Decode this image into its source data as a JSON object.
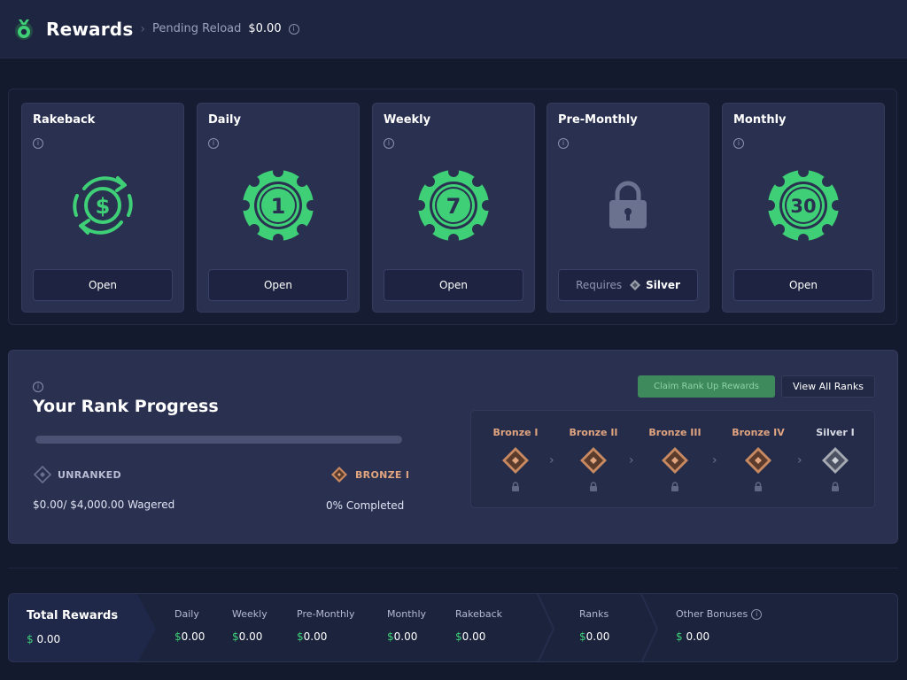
{
  "header": {
    "title": "Rewards",
    "pending_label": "Pending Reload",
    "pending_value": "$0.00"
  },
  "cards": [
    {
      "title": "Rakeback",
      "button": "Open",
      "icon": "rakeback-dollar-icon"
    },
    {
      "title": "Daily",
      "button": "Open",
      "chip_number": "1",
      "icon": "chip-icon"
    },
    {
      "title": "Weekly",
      "button": "Open",
      "chip_number": "7",
      "icon": "chip-icon"
    },
    {
      "title": "Pre-Monthly",
      "button_prefix": "Requires",
      "button_rank": "Silver",
      "icon": "lock-icon"
    },
    {
      "title": "Monthly",
      "button": "Open",
      "chip_number": "30",
      "icon": "chip-icon"
    }
  ],
  "rank": {
    "title": "Your Rank Progress",
    "current_rank": "UNRANKED",
    "next_rank": "BRONZE I",
    "wagered": "$0.00/ $4,000.00 Wagered",
    "completed": "0% Completed",
    "progress_fraction": 0,
    "claim_button": "Claim Rank Up Rewards",
    "view_all_button": "View All Ranks",
    "tiers": [
      {
        "name": "Bronze I"
      },
      {
        "name": "Bronze II"
      },
      {
        "name": "Bronze III"
      },
      {
        "name": "Bronze IV"
      },
      {
        "name": "Silver I"
      }
    ]
  },
  "totals": {
    "label": "Total Rewards",
    "total_currency": "$",
    "total_value": "0.00",
    "columns": [
      {
        "label": "Daily",
        "value": "0.00"
      },
      {
        "label": "Weekly",
        "value": "0.00"
      },
      {
        "label": "Pre-Monthly",
        "value": "0.00"
      },
      {
        "label": "Monthly",
        "value": "0.00"
      },
      {
        "label": "Rakeback",
        "value": "0.00"
      },
      {
        "label": "Ranks",
        "value": "0.00"
      },
      {
        "label": "Other Bonuses",
        "value": "0.00",
        "currency_spaced": true
      }
    ],
    "currency": "$"
  },
  "colors": {
    "accent_green": "#3ecf77",
    "bronze": "#e0a47f",
    "background": "#141a2e",
    "card": "#2a3050"
  }
}
